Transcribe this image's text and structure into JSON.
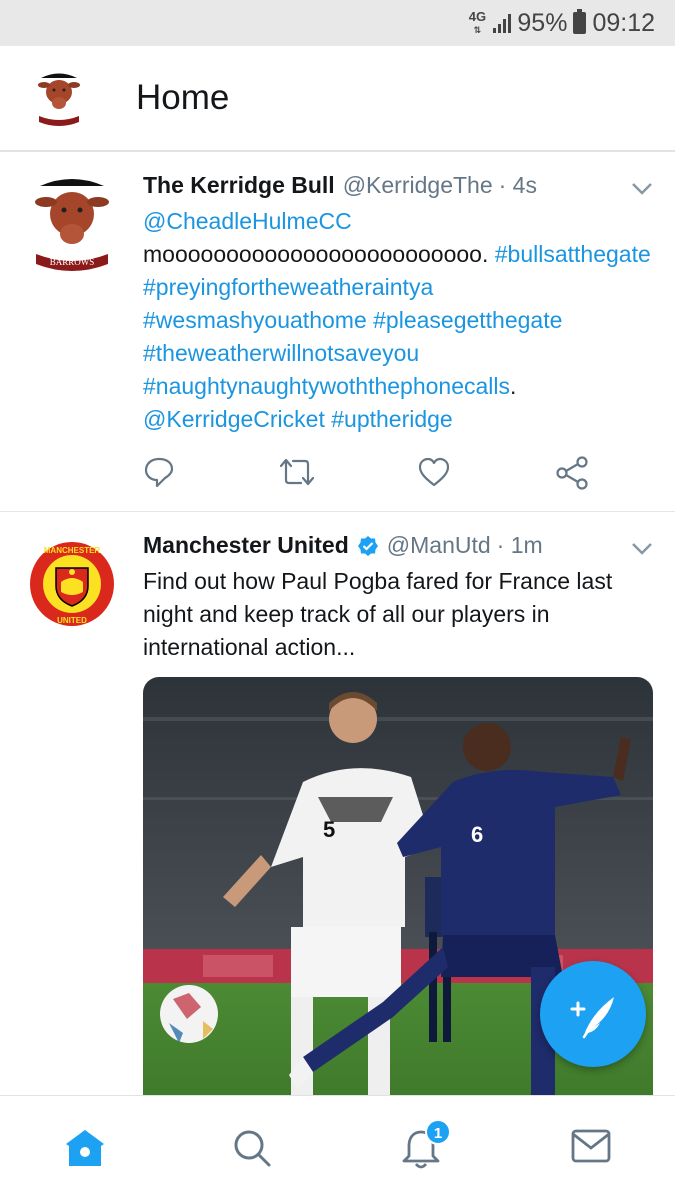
{
  "status_bar": {
    "network": "4G",
    "battery": "95%",
    "time": "09:12"
  },
  "header": {
    "title": "Home",
    "avatar_icon": "bull-logo-icon"
  },
  "tweets": [
    {
      "name": "The Kerridge Bull",
      "handle": "@KerridgeThe",
      "time": "· 4s",
      "avatar_icon": "bull-logo-icon",
      "avatar_caption": "BARROWS",
      "text": [
        {
          "t": "@CheadleHulmeCC",
          "link": true
        },
        {
          "t": " mooooooooooooooooooooooooo. ",
          "link": false
        },
        {
          "t": "#bullsatthegate",
          "link": true
        },
        {
          "t": " ",
          "link": false
        },
        {
          "t": "#preyingfortheweatheraintya",
          "link": true
        },
        {
          "t": " ",
          "link": false
        },
        {
          "t": "#wesmashyouathome",
          "link": true
        },
        {
          "t": " ",
          "link": false
        },
        {
          "t": "#pleasegetthegate",
          "link": true
        },
        {
          "t": " ",
          "link": false
        },
        {
          "t": "#theweatherwillnotsaveyou",
          "link": true
        },
        {
          "t": " ",
          "link": false
        },
        {
          "t": "#naughtynaughtywoththephonecalls",
          "link": true
        },
        {
          "t": ". ",
          "link": false
        },
        {
          "t": "@KerridgeCricket",
          "link": true
        },
        {
          "t": " ",
          "link": false
        },
        {
          "t": "#uptheridge",
          "link": true
        }
      ],
      "actions": [
        "reply-icon",
        "retweet-icon",
        "like-icon",
        "share-icon"
      ]
    },
    {
      "name": "Manchester United",
      "verified": true,
      "handle": "@ManUtd",
      "time": "· 1m",
      "avatar_icon": "manchester-united-crest-icon",
      "avatar_caption_top": "MANCHESTER",
      "avatar_caption_bottom": "UNITED",
      "text": "Find out how Paul Pogba fared for France last night and keep track of all our players in international action...",
      "media": "football-match-photo"
    }
  ],
  "fab": {
    "icon": "compose-tweet-icon"
  },
  "bottom_nav": {
    "items": [
      "home-icon",
      "search-icon",
      "notifications-icon",
      "messages-icon"
    ],
    "notification_count": "1"
  },
  "colors": {
    "accent": "#1da1f2",
    "link": "#1b95e0",
    "secondary_text": "#657786"
  }
}
